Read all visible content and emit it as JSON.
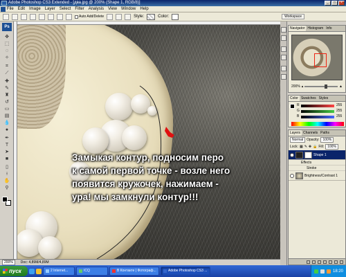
{
  "window": {
    "title": "Adobe Photoshop CS3 Extended - [два.jpg @ 200% (Shape 1, RGB/8)]",
    "buttons": [
      "_",
      "□",
      "×"
    ]
  },
  "menu": [
    "File",
    "Edit",
    "Image",
    "Layer",
    "Select",
    "Filter",
    "Analysis",
    "View",
    "Window",
    "Help"
  ],
  "options": {
    "auto_add_delete": "Auto Add/Delete",
    "style_label": "Style:",
    "color_label": "Color:",
    "workspace": "Workspace"
  },
  "toolbox": {
    "badge": "Ps",
    "tools": [
      "move-tool",
      "marquee-tool",
      "lasso-tool",
      "magic-wand-tool",
      "crop-tool",
      "slice-tool",
      "healing-brush-tool",
      "brush-tool",
      "clone-stamp-tool",
      "history-brush-tool",
      "eraser-tool",
      "gradient-tool",
      "blur-tool",
      "dodge-tool",
      "pen-tool",
      "type-tool",
      "path-selection-tool",
      "shape-tool",
      "notes-tool",
      "eyedropper-tool",
      "hand-tool",
      "zoom-tool"
    ]
  },
  "canvas": {
    "caption_lines": [
      "Замыкая контур, подносим перо",
      "к самой первой точке - возле него",
      "появится кружочек, нажимаем -",
      "ура! мы замкнули контур!!!"
    ]
  },
  "statusbar": {
    "zoom": "200%",
    "doc": "Doc: 4,89M/4,89M"
  },
  "navigator": {
    "tabs": [
      "Navigator",
      "Histogram",
      "Info"
    ],
    "zoom": "200%"
  },
  "color_panel": {
    "tabs": [
      "Color",
      "Swatches",
      "Styles"
    ],
    "channels": [
      {
        "label": "R",
        "value": "255",
        "color": "#ff4444"
      },
      {
        "label": "G",
        "value": "255",
        "color": "#44cc44"
      },
      {
        "label": "B",
        "value": "255",
        "color": "#4466ff"
      }
    ]
  },
  "layers_panel": {
    "tabs": [
      "Layers",
      "Channels",
      "Paths"
    ],
    "blend_mode": "Normal",
    "opacity_label": "Opacity:",
    "opacity": "100%",
    "lock_label": "Lock:",
    "fill_label": "Fill:",
    "fill": "100%",
    "layers": [
      {
        "name": "Shape 1",
        "selected": true
      },
      {
        "name": "Brightness/Contrast 1",
        "selected": false
      }
    ],
    "effects_label": "Effects",
    "stroke_label": "Stroke"
  },
  "taskbar": {
    "start": "пуск",
    "tasks": [
      "2 Internet...",
      "ICQ",
      "В Контакте | Фотограф...",
      "Adobe Photoshop CS3 ..."
    ],
    "active_task": 3,
    "clock": "18:20",
    "colors": {
      "bar": "#2458c8",
      "start": "#2f8f2f",
      "tray": "#0f8ee0"
    }
  },
  "accent": {
    "path_marker": "#e01010",
    "selected_layer": "#0a246a"
  }
}
